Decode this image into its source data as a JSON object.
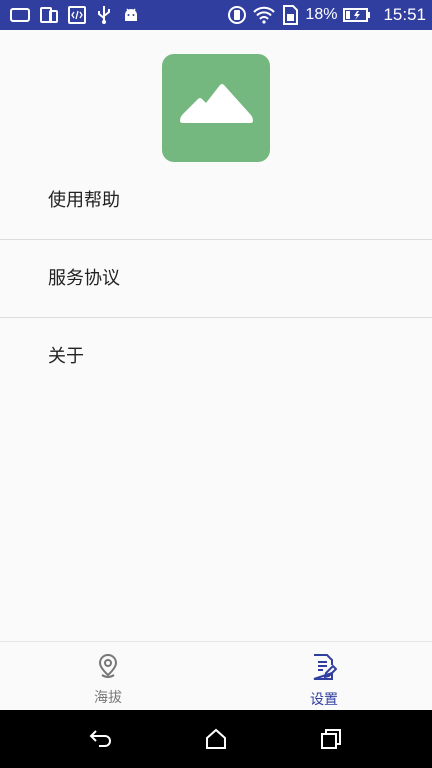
{
  "status_bar": {
    "battery_percent": "18%",
    "time": "15:51",
    "left_icons": [
      "tablet-icon",
      "phone-tablet-icon",
      "code-icon",
      "usb-icon",
      "android-icon"
    ],
    "right_icons": [
      "vibrate-icon",
      "wifi-icon",
      "sim-icon",
      "battery-charging-icon"
    ],
    "background_color": "#303f9f"
  },
  "app_logo": {
    "icon": "mountain-icon",
    "color": "#74b87f"
  },
  "menu": {
    "items": [
      {
        "label": "使用帮助"
      },
      {
        "label": "服务协议"
      },
      {
        "label": "关于"
      }
    ]
  },
  "bottom_nav": {
    "tabs": [
      {
        "label": "海拔",
        "icon": "location-pin-icon",
        "active": false
      },
      {
        "label": "设置",
        "icon": "document-edit-icon",
        "active": true
      }
    ],
    "active_color": "#303f9f",
    "inactive_color": "#777777"
  },
  "system_nav": {
    "buttons": [
      "back-icon",
      "home-icon",
      "recents-icon"
    ]
  }
}
